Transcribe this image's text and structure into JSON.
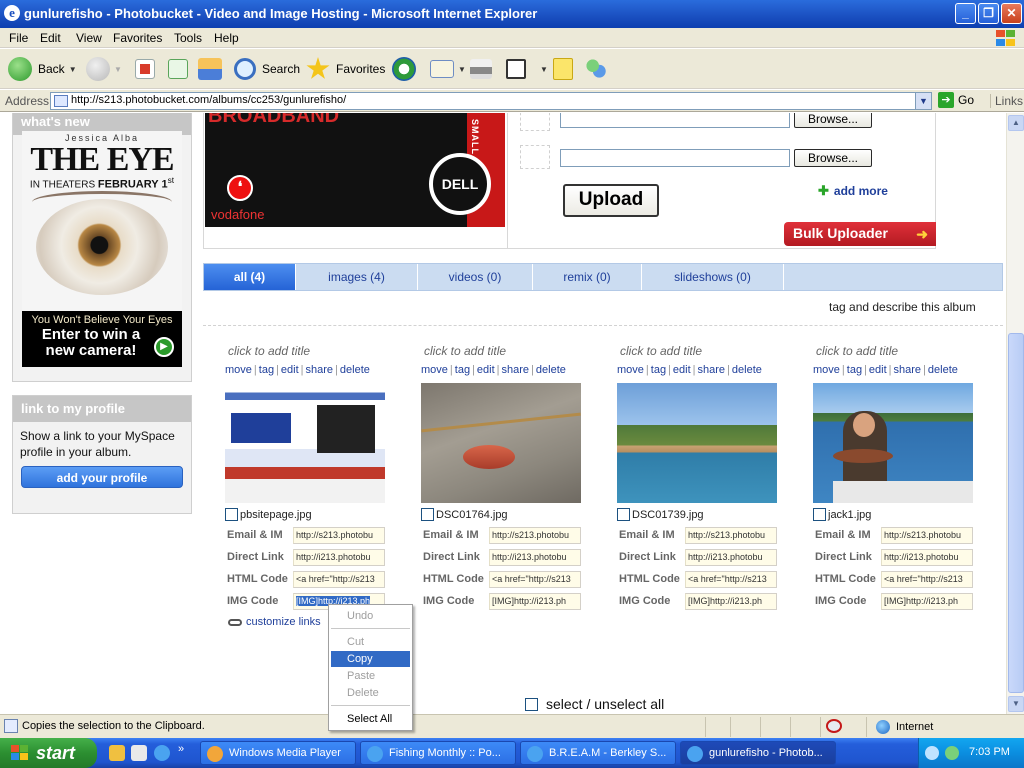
{
  "window": {
    "title": "gunlurefisho - Photobucket - Video and Image Hosting - Microsoft Internet Explorer",
    "logo_letter": "e",
    "min_label": "_",
    "max_label": "❐",
    "close_label": "✕"
  },
  "menu": [
    "File",
    "Edit",
    "View",
    "Favorites",
    "Tools",
    "Help"
  ],
  "toolbar": {
    "back": "Back",
    "search": "Search",
    "favorites": "Favorites"
  },
  "address": {
    "label": "Address",
    "url": "http://s213.photobucket.com/albums/cc253/gunlurefisho/",
    "go": "Go",
    "links": "Links"
  },
  "sidebar": {
    "whats_new": "what's new",
    "ad": {
      "actor": "Jessica Alba",
      "title": "THE EYE",
      "release_prefix": "IN THEATERS",
      "release_date": "FEBRUARY 1",
      "release_suffix": "st",
      "tagline": "You Won't Believe Your Eyes",
      "cta": "Enter to win a new camera!"
    },
    "profile": {
      "heading": "link to my profile",
      "text": "Show a link to your MySpace profile in your album.",
      "button": "add your profile"
    }
  },
  "banner": {
    "headline": "BROADBAND",
    "side_text": "SMALL",
    "brand": "DELL",
    "partner": "vodafone"
  },
  "upload": {
    "browse_label": "Browse...",
    "upload_label": "Upload",
    "add_more": "add more",
    "bulk": "Bulk Uploader"
  },
  "tabs": [
    {
      "label": "all (4)",
      "active": true
    },
    {
      "label": "images (4)",
      "active": false
    },
    {
      "label": "videos (0)",
      "active": false
    },
    {
      "label": "remix (0)",
      "active": false
    },
    {
      "label": "slideshows (0)",
      "active": false
    }
  ],
  "tag_describe": "tag and describe this album",
  "card_actions": [
    "move",
    "tag",
    "edit",
    "share",
    "delete"
  ],
  "link_labels": {
    "email": "Email & IM",
    "direct": "Direct Link",
    "html": "HTML Code",
    "img": "IMG Code"
  },
  "photos": [
    {
      "title": "click to add title",
      "filename": "pbsitepage.jpg",
      "email": "http://s213.photobu",
      "direct": "http://i213.photobu",
      "html": "<a href=\"http://s213",
      "img": "[IMG]http://i213.ph",
      "img_selected": true
    },
    {
      "title": "click to add title",
      "filename": "DSC01764.jpg",
      "email": "http://s213.photobu",
      "direct": "http://i213.photobu",
      "html": "<a href=\"http://s213",
      "img": "[IMG]http://i213.ph",
      "img_selected": false
    },
    {
      "title": "click to add title",
      "filename": "DSC01739.jpg",
      "email": "http://s213.photobu",
      "direct": "http://i213.photobu",
      "html": "<a href=\"http://s213",
      "img": "[IMG]http://i213.ph",
      "img_selected": false
    },
    {
      "title": "click to add title",
      "filename": "jack1.jpg",
      "email": "http://s213.photobu",
      "direct": "http://i213.photobu",
      "html": "<a href=\"http://s213",
      "img": "[IMG]http://i213.ph",
      "img_selected": false
    }
  ],
  "customize_links": "customize links",
  "select_all": "select / unselect all",
  "context_menu": {
    "undo": "Undo",
    "cut": "Cut",
    "copy": "Copy",
    "paste": "Paste",
    "delete": "Delete",
    "select_all": "Select All"
  },
  "status": {
    "text": "Copies the selection to the Clipboard.",
    "zone": "Internet"
  },
  "taskbar": {
    "start": "start",
    "items": [
      "Windows Media Player",
      "Fishing Monthly :: Po...",
      "B.R.E.A.M - Berkley S...",
      "gunlurefisho - Photob..."
    ],
    "clock": "7:03 PM"
  }
}
